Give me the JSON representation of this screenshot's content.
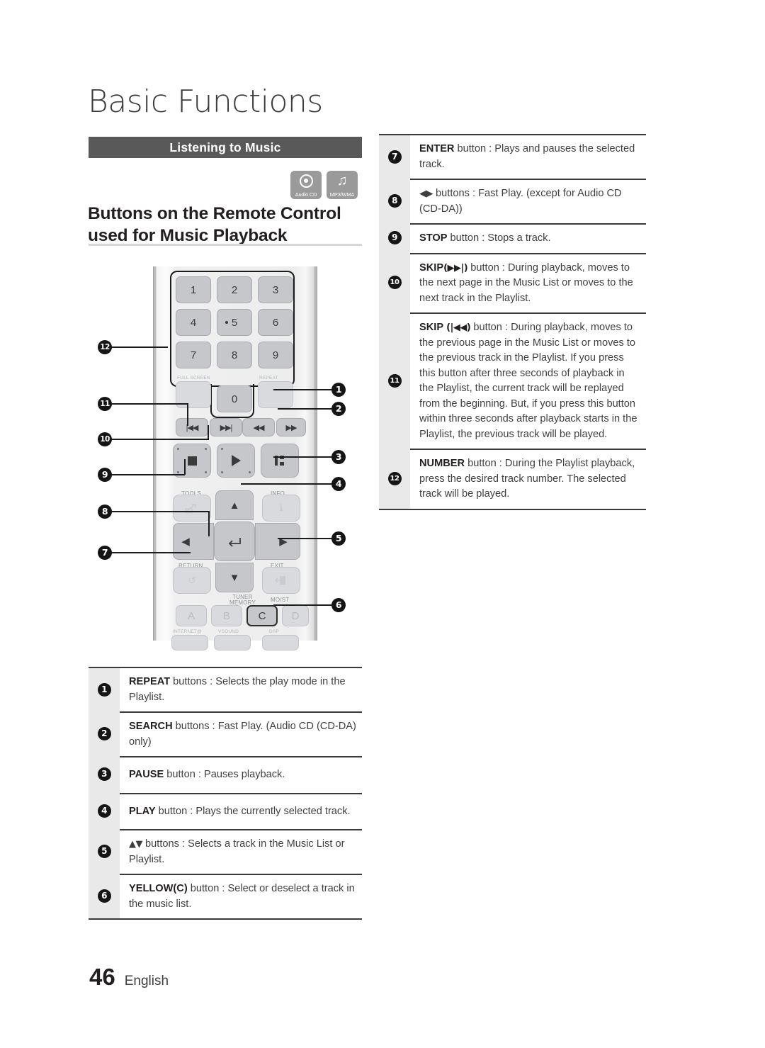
{
  "page": {
    "chapter_title": "Basic Functions",
    "section_bar_label": "Listening to Music",
    "main_heading": "Buttons on the Remote Control used for Music Playback",
    "page_number": "46",
    "language": "English"
  },
  "media_badges": [
    {
      "icon": "audio-cd-disc-icon",
      "caption": "Audio CD"
    },
    {
      "icon": "music-note-icon",
      "caption": "MP3/WMA"
    }
  ],
  "right_table": {
    "rows": [
      {
        "number": "7",
        "icon": "",
        "bold": "ENTER",
        "text": " button : Plays and pauses the selected track.",
        "full_text": "ENTER button : Plays and pauses the selected track."
      },
      {
        "number": "8",
        "icon": "◀▶",
        "bold": "",
        "text": " buttons : Fast Play. (except for Audio CD (CD-DA))",
        "full_text": "◀▶ buttons : Fast Play. (except for Audio CD (CD-DA))"
      },
      {
        "number": "9",
        "icon": "",
        "bold": "STOP",
        "text": " button : Stops a track.",
        "full_text": "STOP button : Stops a track."
      },
      {
        "number": "10",
        "icon": "▶▶|",
        "bold": "SKIP",
        "text": " button : During playback, moves to the next page in the Music List or moves to the next track in the Playlist.",
        "full_text": "SKIP(▶▶|) button : During playback, moves to the next page in the Music List or moves to the next track in the Playlist."
      },
      {
        "number": "11",
        "icon": "|◀◀",
        "bold": "SKIP",
        "text": " button : During playback, moves to the previous page in the Music List or moves to the previous track in the Playlist. If you press this button after three seconds of playback in the Playlist, the current track will be replayed from the beginning. But, if you press this button within three seconds after playback starts in the Playlist, the previous track will be played.",
        "full_text": "SKIP (|◀◀)button : During playback, moves to the previous page in the Music List or moves to the previous track in the Playlist. If you press this button after three seconds of playback in the Playlist, the current track will be replayed from the beginning. But, if you press this button within three seconds after playback starts in the Playlist, the previous track will be played."
      },
      {
        "number": "12",
        "icon": "",
        "bold": "NUMBER",
        "text": " button : During the Playlist playback, press the desired track number. The selected track will be played.",
        "full_text": "NUMBER button : During the Playlist playback, press the desired track number. The selected track will be played."
      }
    ]
  },
  "left_table": {
    "rows": [
      {
        "number": "1",
        "icon": "",
        "bold": "REPEAT",
        "text": " buttons : Selects the play mode in the Playlist.",
        "full_text": "REPEAT buttons : Selects the play mode in the Playlist."
      },
      {
        "number": "2",
        "icon": "",
        "bold": "SEARCH",
        "text": " buttons : Fast Play. (Audio CD (CD-DA) only)",
        "full_text": "SEARCH buttons : Fast Play. (Audio CD (CD-DA) only)"
      },
      {
        "number": "3",
        "icon": "",
        "bold": "PAUSE",
        "text": " button : Pauses playback.",
        "full_text": "PAUSE button : Pauses playback."
      },
      {
        "number": "4",
        "icon": "",
        "bold": "PLAY",
        "text": " button : Plays the currently selected track.",
        "full_text": "PLAY button : Plays the currently selected track."
      },
      {
        "number": "5",
        "icon": "▲▼",
        "bold": "",
        "text": " buttons : Selects a track in the Music List or Playlist.",
        "full_text": "▲▼ buttons : Selects a track in the Music List or Playlist."
      },
      {
        "number": "6",
        "icon": "",
        "bold": "YELLOW(C)",
        "text": " button : Select or deselect a track in the music list.",
        "full_text": "YELLOW(C) button : Select or deselect a track in the music list."
      }
    ]
  },
  "remote": {
    "keypad": [
      "1",
      "2",
      "3",
      "4",
      "5",
      "6",
      "7",
      "8",
      "9",
      "0"
    ],
    "keypad_labels": {
      "full_screen": "FULL SCREEN",
      "repeat": "REPEAT"
    },
    "transport": {
      "skip_back": "|◀◀",
      "skip_fwd": "▶▶|",
      "rewind": "◀◀",
      "forward": "▶▶"
    },
    "nav_labels": {
      "tools": "TOOLS",
      "info": "INFO",
      "return": "RETURN",
      "exit": "EXIT"
    },
    "color_buttons": [
      "A",
      "B",
      "C",
      "D"
    ],
    "color_labels": {
      "tuner": "TUNER",
      "memory": "MEMORY",
      "most": "MO/ST"
    },
    "bottom_labels": {
      "internet": "INTERNET@",
      "vsound": "VSOUND",
      "dsp": "DSP"
    },
    "callouts_left": [
      "12",
      "11",
      "10",
      "9",
      "8",
      "7"
    ],
    "callouts_right": [
      "1",
      "2",
      "3",
      "4",
      "5",
      "6"
    ]
  }
}
